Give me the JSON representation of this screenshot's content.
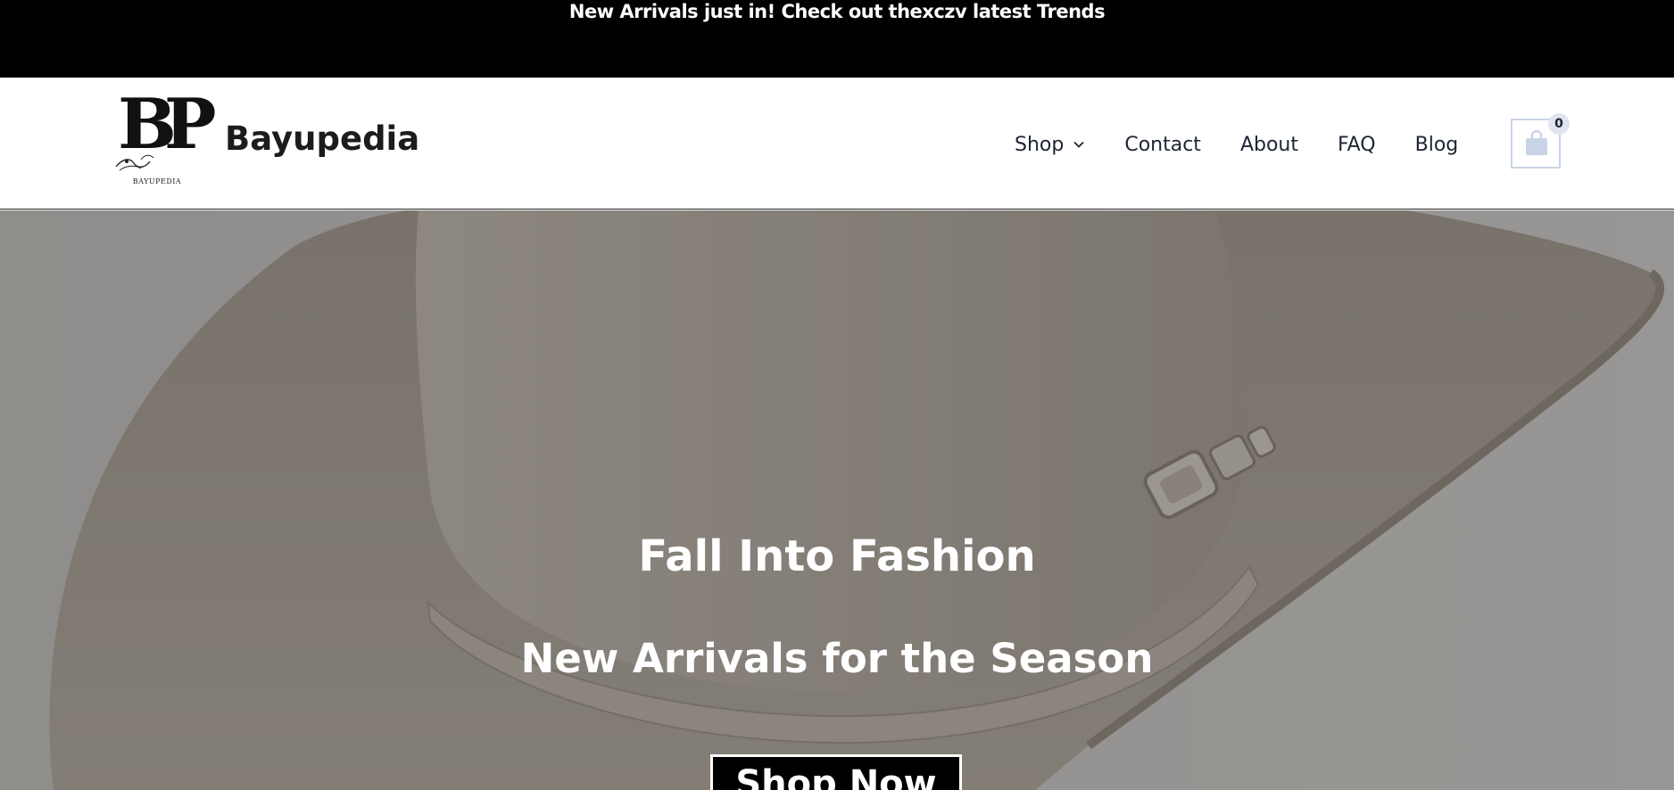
{
  "announcement": {
    "text": "New Arrivals just in! Check out thexczv latest Trends"
  },
  "header": {
    "logo": {
      "letters": "BP",
      "caption": "BAYUPEDIA"
    },
    "site_title": "Bayupedia",
    "nav": [
      {
        "label": "Shop",
        "has_dropdown": true
      },
      {
        "label": "Contact"
      },
      {
        "label": "About"
      },
      {
        "label": "FAQ"
      },
      {
        "label": "Blog"
      }
    ],
    "cart": {
      "count": "0",
      "icon": "shopping-bag-icon"
    }
  },
  "hero": {
    "title": "Fall Into Fashion",
    "subtitle": "New Arrivals for the Season",
    "button_label": "Shop Now",
    "image": "cowboy-hat"
  },
  "colors": {
    "announcement_bg": "#000000",
    "header_bg": "#ffffff",
    "nav_text": "#1d2433",
    "cart_border": "#c9d3e6",
    "hero_text": "#ffffff",
    "button_bg": "#000000"
  }
}
